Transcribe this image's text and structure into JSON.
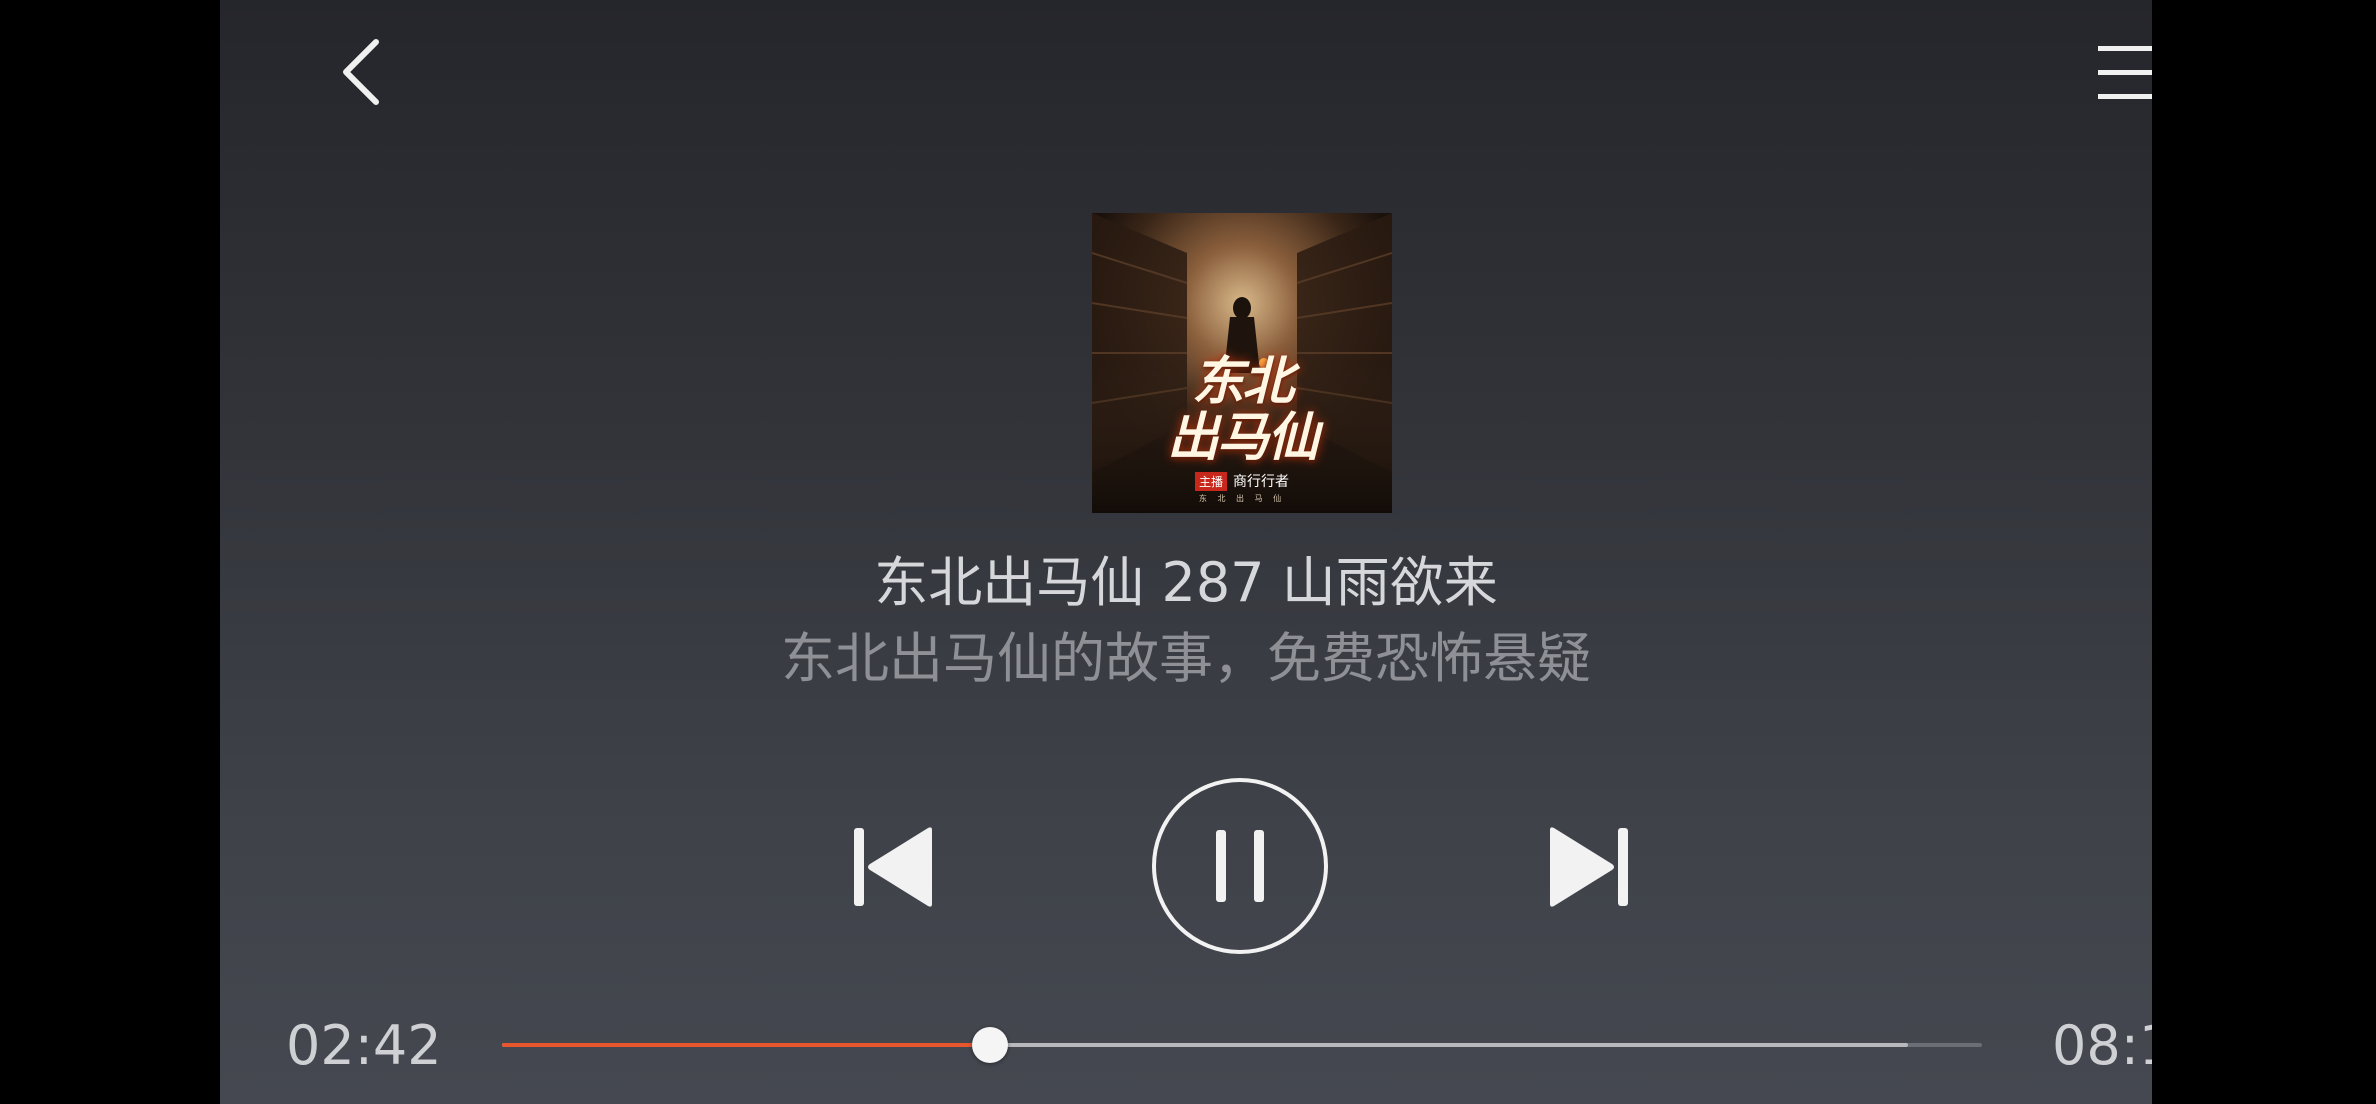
{
  "header": {
    "back_icon": "chevron-left-icon",
    "menu_icon": "hamburger-menu-icon"
  },
  "cover": {
    "title_line1": "东北",
    "title_line2": "出马仙",
    "host_tag": "主播",
    "host_name": "商行行者",
    "small_text": "东 北 出 马 仙"
  },
  "track": {
    "title": "东北出马仙 287 山雨欲来",
    "subtitle": "东北出马仙的故事，免费恐怖悬疑"
  },
  "controls": {
    "prev_icon": "skip-previous-icon",
    "pause_icon": "pause-icon",
    "next_icon": "skip-next-icon"
  },
  "progress": {
    "current_time": "02:42",
    "total_time": "08:1",
    "played_fraction": 0.33,
    "buffered_fraction": 0.95,
    "played_color": "#e8562d",
    "buffer_color": "#b8b9bd"
  }
}
